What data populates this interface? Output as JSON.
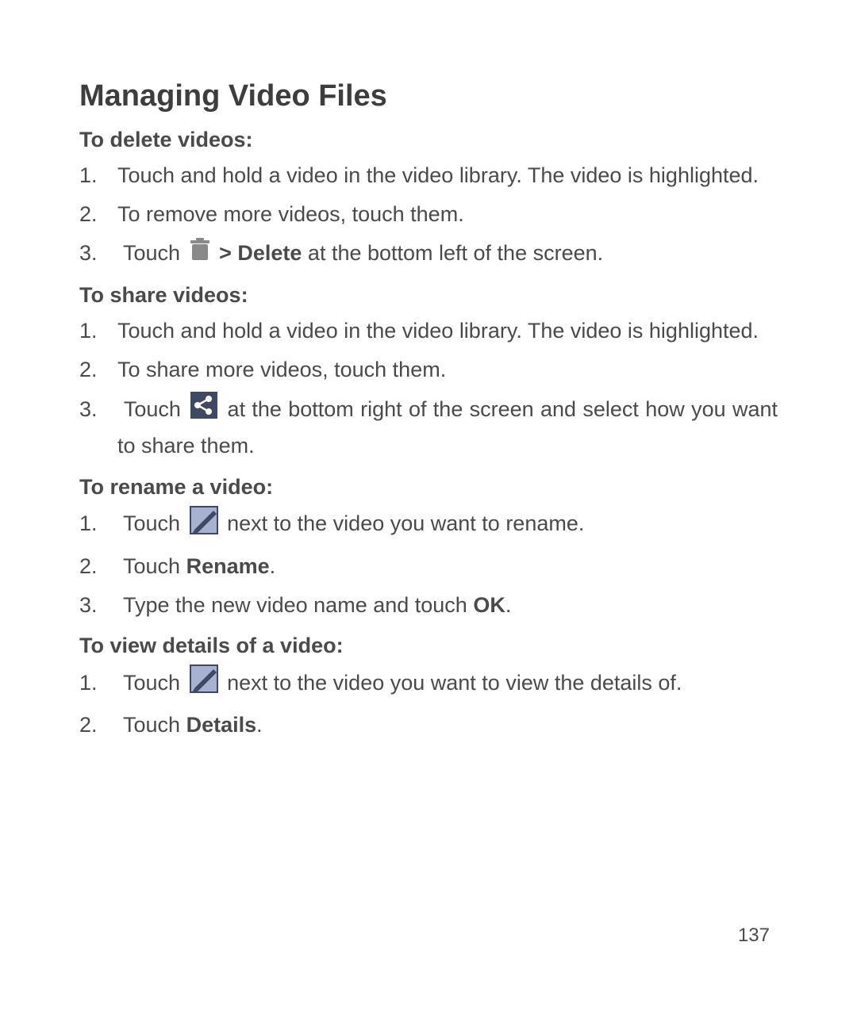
{
  "page": {
    "title": "Managing Video Files",
    "page_number": "137"
  },
  "sections": {
    "delete": {
      "heading": "To delete videos:",
      "steps": {
        "s1": "Touch and hold a video in the video library. The video is high­lighted.",
        "s2": "To remove more videos, touch them.",
        "s3_a": "Touch ",
        "s3_b": " > Delete",
        "s3_c": " at the bottom left of the screen."
      }
    },
    "share": {
      "heading": "To share videos:",
      "steps": {
        "s1": "Touch and hold a video in the video library. The video is high­lighted.",
        "s2": "To share more videos, touch them.",
        "s3_a": "Touch ",
        "s3_b": " at the bottom right of the screen and select how you want to share them."
      }
    },
    "rename": {
      "heading": "To rename a video:",
      "steps": {
        "s1_a": "Touch ",
        "s1_b": " next to the video you want to rename.",
        "s2_a": "Touch ",
        "s2_b": "Rename",
        "s2_c": ".",
        "s3_a": "Type the new video name and touch ",
        "s3_b": "OK",
        "s3_c": "."
      }
    },
    "details": {
      "heading": "To view details of a video:",
      "steps": {
        "s1_a": "Touch ",
        "s1_b": " next to the video you want to view the details of.",
        "s2_a": "Touch ",
        "s2_b": "Details",
        "s2_c": "."
      }
    }
  },
  "icons": {
    "trash": "trash-icon",
    "share": "share-icon",
    "edit": "edit-icon"
  }
}
